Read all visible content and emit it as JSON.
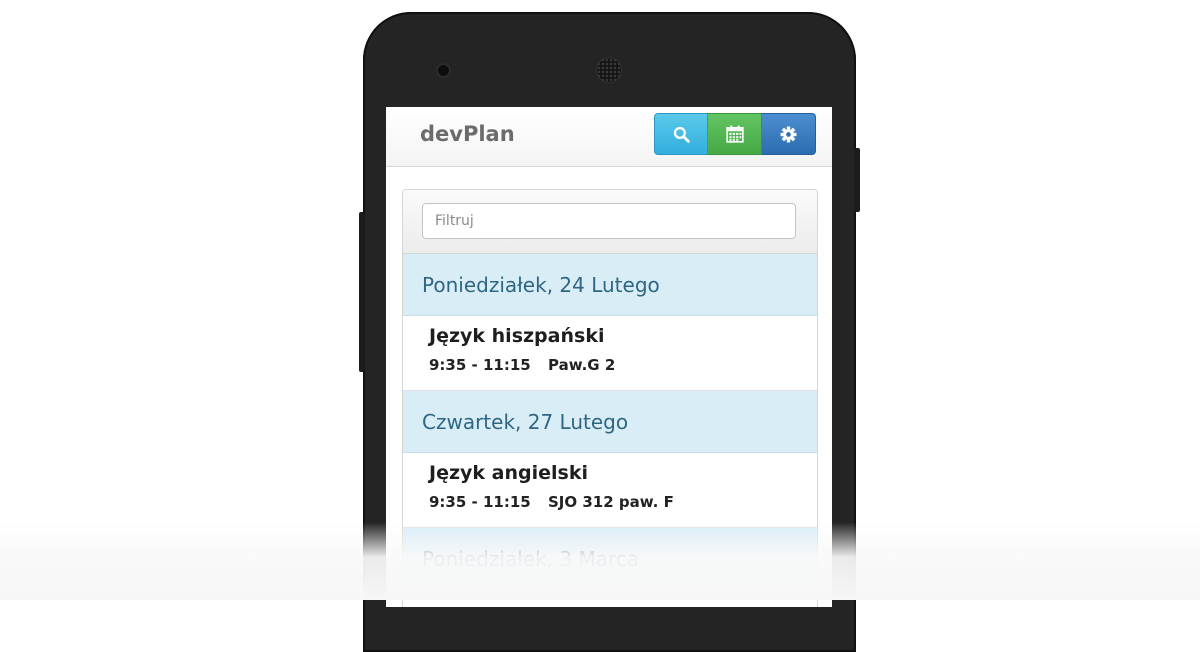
{
  "app": {
    "brand": "devPlan"
  },
  "toolbar": {
    "search_icon": "search-icon",
    "calendar_icon": "calendar-icon",
    "settings_icon": "gear-icon",
    "colors": {
      "search": "#39b3e0",
      "calendar": "#4cb04c",
      "settings": "#3477bd"
    }
  },
  "filter": {
    "placeholder": "Filtruj",
    "value": ""
  },
  "days": [
    {
      "header": "Poniedziałek, 24 Lutego",
      "lessons": [
        {
          "name": "Język hiszpański",
          "time": "9:35 - 11:15",
          "room": "Paw.G 2"
        }
      ]
    },
    {
      "header": "Czwartek, 27 Lutego",
      "lessons": [
        {
          "name": "Język angielski",
          "time": "9:35 - 11:15",
          "room": "SJO 312 paw. F"
        }
      ]
    },
    {
      "header": "Poniedziałek, 3 Marca",
      "lessons": []
    }
  ]
}
